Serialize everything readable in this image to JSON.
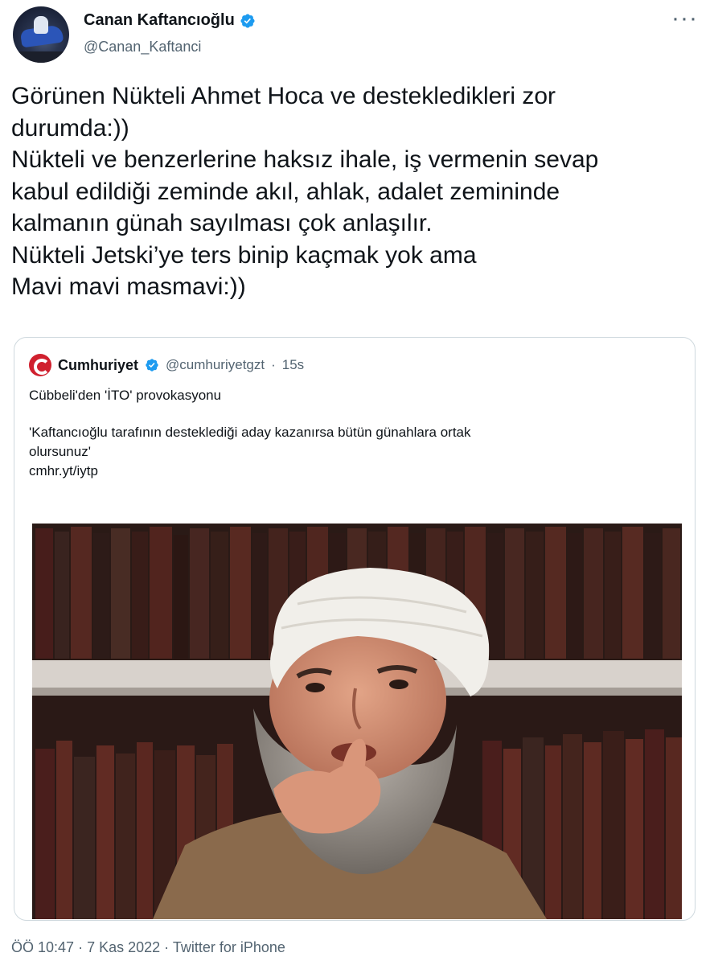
{
  "author": {
    "display_name": "Canan Kaftancıoğlu",
    "handle": "@Canan_Kaftanci",
    "verified": true,
    "avatar_icon": "avatar-jetski-photo"
  },
  "more_label": "···",
  "tweet_lines": [
    "Görünen  Nükteli Ahmet Hoca ve destekledikleri zor",
    "durumda:))",
    "Nükteli ve benzerlerine haksız ihale, iş vermenin sevap",
    "kabul edildiği zeminde akıl, ahlak, adalet zemininde",
    "kalmanın günah sayılması çok anlaşılır.",
    "Nükteli Jetski’ye ters binip kaçmak yok ama",
    "Mavi mavi masmavi:))"
  ],
  "quote": {
    "display_name": "Cumhuriyet",
    "handle": "@cumhuriyetgzt",
    "separator": "·",
    "time": "15s",
    "title": "Cübbeli'den 'İTO' provokasyonu",
    "quote_line1": "'Kaftancıoğlu tarafının desteklediği aday kazanırsa bütün günahlara ortak",
    "quote_line2": "olursunuz'",
    "link": "cmhr.yt/iytp"
  },
  "footer": {
    "time": "ÖÖ 10:47",
    "date": "7 Kas 2022",
    "source": "Twitter for iPhone",
    "separator": "·"
  },
  "colors": {
    "verified_blue": "#1d9bf0",
    "text_primary": "#0f1419",
    "text_secondary": "#536471",
    "border": "#cfd9de",
    "cumhuriyet_red": "#d0202e"
  }
}
